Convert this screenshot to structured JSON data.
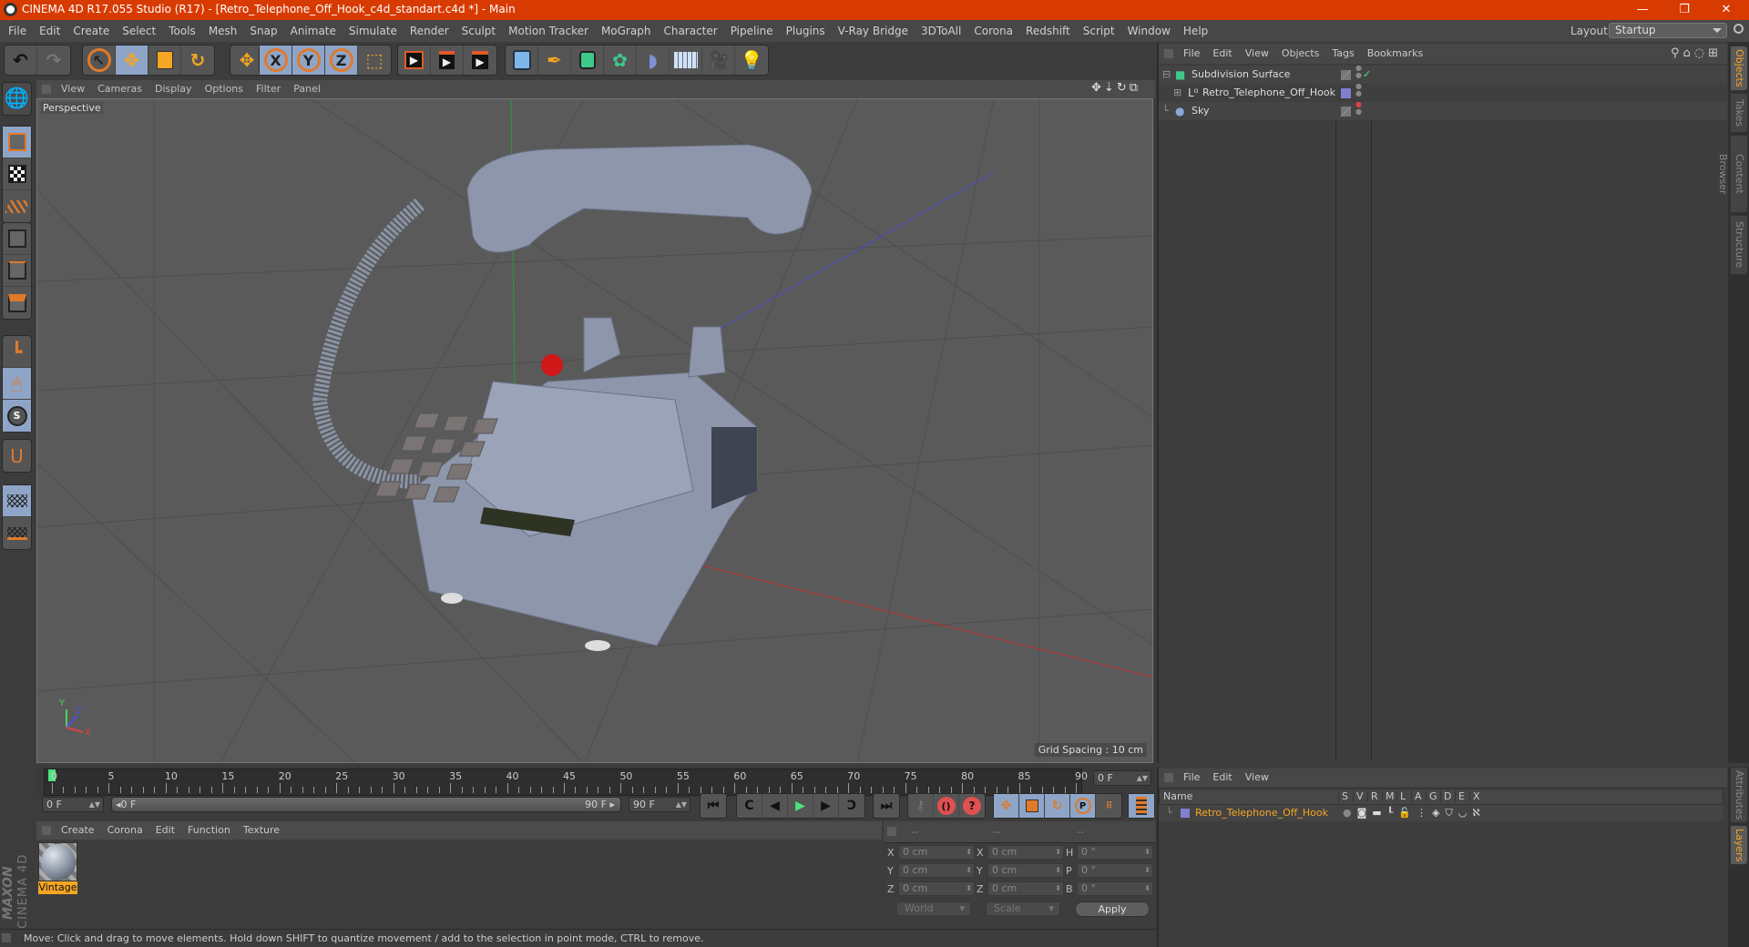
{
  "window": {
    "title": "CINEMA 4D R17.055 Studio (R17) - [Retro_Telephone_Off_Hook_c4d_standart.c4d *] - Main",
    "controls": {
      "minimize": "—",
      "restore": "❐",
      "close": "✕"
    },
    "accent_color": "#d83b01"
  },
  "menubar": {
    "items": [
      "File",
      "Edit",
      "Create",
      "Select",
      "Tools",
      "Mesh",
      "Snap",
      "Animate",
      "Simulate",
      "Render",
      "Sculpt",
      "Motion Tracker",
      "MoGraph",
      "Character",
      "Pipeline",
      "Plugins",
      "V-Ray Bridge",
      "3DToAll",
      "Corona",
      "Redshift",
      "Script",
      "Window",
      "Help"
    ],
    "layout_label": "Layout:",
    "layout_value": "Startup"
  },
  "toolbar": {
    "undo_icon": "undo-icon",
    "redo_icon": "redo-icon",
    "tools": [
      "select",
      "move",
      "scale",
      "rotate",
      "move-axis"
    ],
    "axes": [
      "X",
      "Y",
      "Z"
    ],
    "coord_icon": "world-coordinates-icon",
    "render_tools": [
      "render-view",
      "render-picture-viewer",
      "render-settings"
    ],
    "create_tools": [
      "cube",
      "pen",
      "subdivision",
      "cloner",
      "deformer",
      "floor",
      "camera",
      "light"
    ]
  },
  "viewport": {
    "menu": [
      "View",
      "Cameras",
      "Display",
      "Options",
      "Filter",
      "Panel"
    ],
    "camera_label": "Perspective",
    "grid_spacing": "Grid Spacing : 10 cm",
    "axis_labels": {
      "x": "X",
      "y": "Y",
      "z": "Z"
    }
  },
  "timeline": {
    "ticks": [
      "0",
      "5",
      "10",
      "15",
      "20",
      "25",
      "30",
      "35",
      "40",
      "45",
      "50",
      "55",
      "60",
      "65",
      "70",
      "75",
      "80",
      "85",
      "90"
    ],
    "current_frame_display": "0 F",
    "start_field": "0 F",
    "range_start": "0 F",
    "range_end": "90 F",
    "end_field": "90 F",
    "playhead_frame": 0
  },
  "materials": {
    "menu": [
      "Create",
      "Corona",
      "Edit",
      "Function",
      "Texture"
    ],
    "items": [
      {
        "name": "Vintage"
      }
    ]
  },
  "coordinates": {
    "headers": [
      "--",
      "--",
      "--"
    ],
    "rows": [
      {
        "l1": "X",
        "v1": "0 cm",
        "l2": "X",
        "v2": "0 cm",
        "l3": "H",
        "v3": "0 °"
      },
      {
        "l1": "Y",
        "v1": "0 cm",
        "l2": "Y",
        "v2": "0 cm",
        "l3": "P",
        "v3": "0 °"
      },
      {
        "l1": "Z",
        "v1": "0 cm",
        "l2": "Z",
        "v2": "0 cm",
        "l3": "B",
        "v3": "0 °"
      }
    ],
    "mode": "World",
    "transform": "Scale",
    "apply_label": "Apply"
  },
  "status": {
    "text": "Move: Click and drag to move elements. Hold down SHIFT to quantize movement / add to the selection in point mode, CTRL to remove."
  },
  "objects": {
    "menu": [
      "File",
      "Edit",
      "View",
      "Objects",
      "Tags",
      "Bookmarks"
    ],
    "items": [
      {
        "name": "Subdivision Surface",
        "icon": "subdivision-icon",
        "check": "✓"
      },
      {
        "name": "Retro_Telephone_Off_Hook",
        "icon": "null-object-icon",
        "layer_color": "#8080d0"
      },
      {
        "name": "Sky",
        "icon": "sky-icon"
      }
    ]
  },
  "side_tabs_top": [
    {
      "label": "Objects",
      "active": true
    },
    {
      "label": "Takes",
      "active": false
    },
    {
      "label": "Content Browser",
      "active": false
    },
    {
      "label": "Structure",
      "active": false
    }
  ],
  "side_tabs_bottom": [
    {
      "label": "Attributes",
      "active": false
    },
    {
      "label": "Layers",
      "active": true
    }
  ],
  "layers": {
    "menu": [
      "File",
      "Edit",
      "View"
    ],
    "columns": [
      "Name",
      "S",
      "V",
      "R",
      "M",
      "L",
      "A",
      "G",
      "D",
      "E",
      "X"
    ],
    "items": [
      {
        "name": "Retro_Telephone_Off_Hook",
        "color": "#8080d0"
      }
    ]
  },
  "branding": {
    "line1": "MAXON",
    "line2": "CINEMA 4D"
  }
}
